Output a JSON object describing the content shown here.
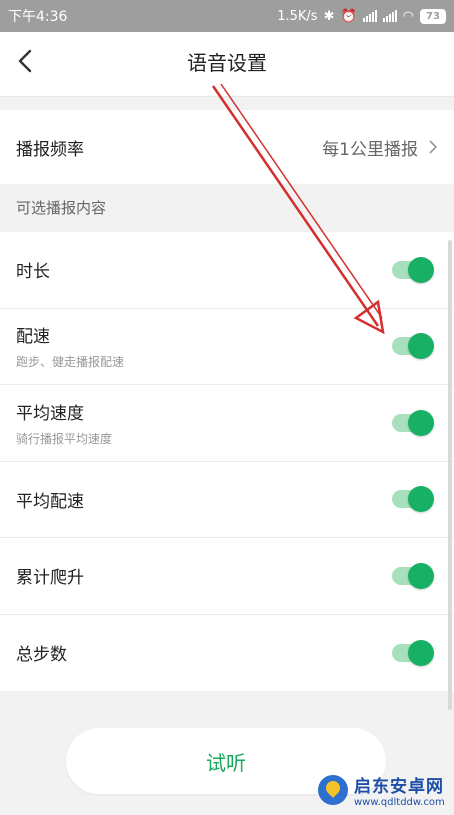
{
  "status_bar": {
    "time": "下午4:36",
    "network_speed": "1.5K/s",
    "battery": "73"
  },
  "nav": {
    "title": "语音设置"
  },
  "frequency": {
    "label": "播报频率",
    "value": "每1公里播报"
  },
  "section": {
    "header": "可选播报内容"
  },
  "items": [
    {
      "title": "时长",
      "subtitle": "",
      "enabled": true
    },
    {
      "title": "配速",
      "subtitle": "跑步、健走播报配速",
      "enabled": true
    },
    {
      "title": "平均速度",
      "subtitle": "骑行播报平均速度",
      "enabled": true
    },
    {
      "title": "平均配速",
      "subtitle": "",
      "enabled": true
    },
    {
      "title": "累计爬升",
      "subtitle": "",
      "enabled": true
    },
    {
      "title": "总步数",
      "subtitle": "",
      "enabled": true
    }
  ],
  "listen_button": {
    "label": "试听"
  },
  "watermark": {
    "name": "启东安卓网",
    "url": "www.qdltddw.com"
  },
  "colors": {
    "accent": "#18b064",
    "annotation": "#d32f2f"
  }
}
